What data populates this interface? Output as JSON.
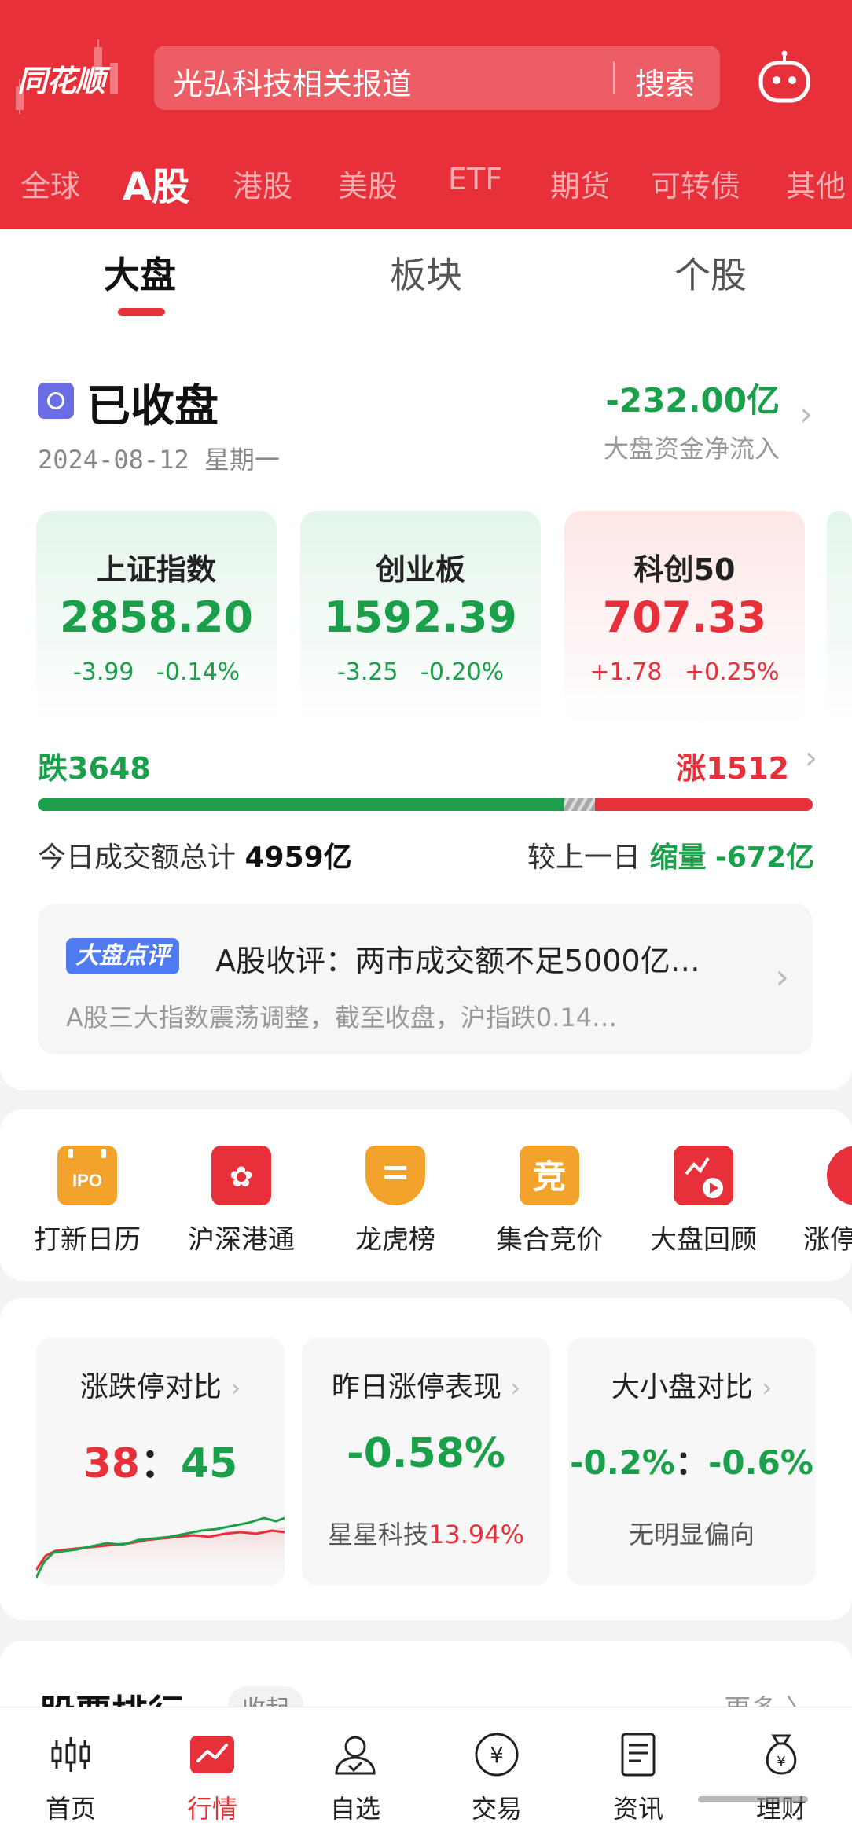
{
  "header": {
    "logo": "同花顺",
    "search_placeholder": "光弘科技相关报道",
    "search_button": "搜索",
    "market_tabs": [
      "全球",
      "A股",
      "港股",
      "美股",
      "ETF",
      "期货",
      "可转债",
      "其他"
    ],
    "active_market_tab": "A股",
    "bg_color": "#e8303a"
  },
  "sub_tabs": [
    "大盘",
    "板块",
    "个股"
  ],
  "active_sub_tab": "大盘",
  "market_status": {
    "title": "已收盘",
    "date": "2024-08-12 星期一",
    "net_flow_value": "-232.00亿",
    "net_flow_label": "大盘资金净流入"
  },
  "indices": [
    {
      "name": "上证指数",
      "value": "2858.20",
      "change": "-3.99",
      "pct": "-0.14%",
      "trend": "down"
    },
    {
      "name": "创业板",
      "value": "1592.39",
      "change": "-3.25",
      "pct": "-0.20%",
      "trend": "down"
    },
    {
      "name": "科创50",
      "value": "707.33",
      "change": "+1.78",
      "pct": "+0.25%",
      "trend": "up"
    }
  ],
  "breadth": {
    "fall_label": "跌3648",
    "rise_label": "涨1512",
    "fall_count": 3648,
    "rise_count": 1512
  },
  "volume": {
    "label": "今日成交额总计",
    "value": "4959亿",
    "compare_label": "较上一日",
    "compare_word": "缩量",
    "compare_value": "-672亿"
  },
  "news": {
    "badge": "大盘点评",
    "title": "A股收评：两市成交额不足5000亿…",
    "summary": "A股三大指数震荡调整，截至收盘，沪指跌0.14…"
  },
  "tools": [
    {
      "label": "打新日历",
      "icon": "ipo-calendar-icon",
      "color": "#f3a22c",
      "glyph": "IPO"
    },
    {
      "label": "沪深港通",
      "icon": "hk-connect-icon",
      "color": "#e8303a",
      "glyph": "✿"
    },
    {
      "label": "龙虎榜",
      "icon": "dragon-tiger-icon",
      "color": "#f3a22c",
      "glyph": "〓"
    },
    {
      "label": "集合竞价",
      "icon": "auction-icon",
      "color": "#f3a22c",
      "glyph": "竞"
    },
    {
      "label": "大盘回顾",
      "icon": "market-review-icon",
      "color": "#e8303a",
      "glyph": "▶"
    },
    {
      "label": "涨停",
      "icon": "limit-up-icon",
      "color": "#e8303a",
      "glyph": "◀"
    }
  ],
  "stats": {
    "limit_compare": {
      "title": "涨跌停对比",
      "down": "38",
      "sep": "：",
      "up": "45"
    },
    "yesterday_limit": {
      "title": "昨日涨停表现",
      "value": "-0.58%",
      "stock": "星星科技",
      "stock_pct": "13.94%"
    },
    "size_compare": {
      "title": "大小盘对比",
      "large": "-0.2%",
      "sep": "：",
      "small": "-0.6%",
      "note": "无明显偏向"
    }
  },
  "ranking": {
    "title": "股票排行",
    "collapse": "收起",
    "more": "更多 〉"
  },
  "bottom_nav": [
    {
      "label": "首页",
      "icon": "candlestick-icon"
    },
    {
      "label": "行情",
      "icon": "market-chart-icon"
    },
    {
      "label": "自选",
      "icon": "user-watchlist-icon"
    },
    {
      "label": "交易",
      "icon": "yen-coin-icon"
    },
    {
      "label": "资讯",
      "icon": "news-doc-icon"
    },
    {
      "label": "理财",
      "icon": "money-bag-icon"
    }
  ],
  "active_bottom_nav": "行情"
}
